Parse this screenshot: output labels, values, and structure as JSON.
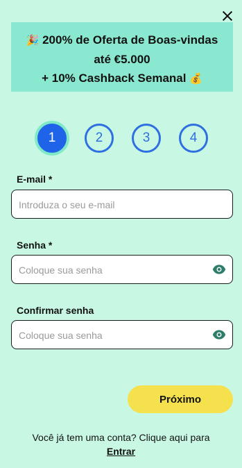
{
  "banner": {
    "emoji1": "🎉",
    "line1": "200% de Oferta de Boas-vindas",
    "line2": "até €5.000",
    "line3": "+ 10% Cashback Semanal",
    "emoji2": "💰"
  },
  "steps": [
    "1",
    "2",
    "3",
    "4"
  ],
  "form": {
    "email": {
      "label": "E-mail *",
      "placeholder": "Introduza o seu e-mail"
    },
    "password": {
      "label": "Senha *",
      "placeholder": "Coloque sua senha"
    },
    "confirm": {
      "label": "Confirmar senha",
      "placeholder": "Coloque sua senha"
    }
  },
  "next_label": "Próximo",
  "footer": {
    "text": "Você já tem uma conta? Clique aqui para",
    "link": "Entrar"
  },
  "colors": {
    "background": "#c8f8e4",
    "banner": "#8ae8d0",
    "step": "#2f6fe0",
    "button": "#f5e14e",
    "eye": "#2e7d6b"
  },
  "icons": [
    "close-icon",
    "eye-icon"
  ]
}
